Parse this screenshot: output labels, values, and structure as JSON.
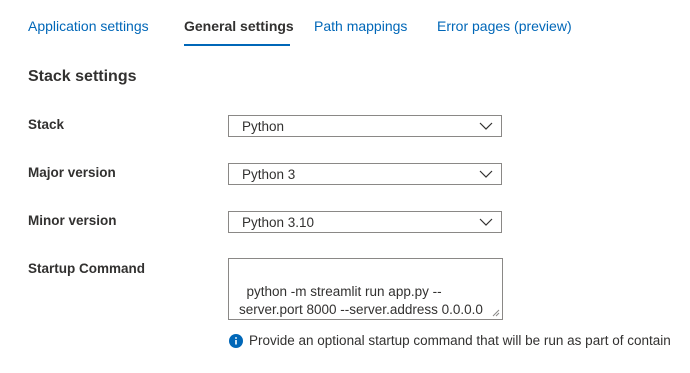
{
  "tabs": [
    {
      "label": "Application settings"
    },
    {
      "label": "General settings"
    },
    {
      "label": "Path mappings"
    },
    {
      "label": "Error pages (preview)"
    }
  ],
  "section": {
    "title": "Stack settings"
  },
  "fields": {
    "stack": {
      "label": "Stack",
      "value": "Python"
    },
    "major_version": {
      "label": "Major version",
      "value": "Python 3"
    },
    "minor_version": {
      "label": "Minor version",
      "value": "Python 3.10"
    },
    "startup_command": {
      "label": "Startup Command",
      "value": "python -m streamlit run app.py --\nserver.port 8000 --server.address 0.0.0.0",
      "hint": "Provide an optional startup command that will be run as part of contain"
    }
  },
  "icons": {
    "dropdown": "chevron-down-icon",
    "info": "info-icon",
    "resize": "resize-grip-icon"
  },
  "colors": {
    "accent": "#0067b8",
    "text": "#323130",
    "border": "#8a8886"
  }
}
